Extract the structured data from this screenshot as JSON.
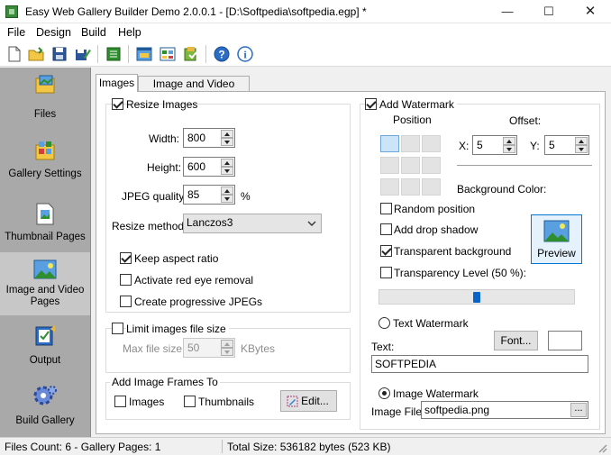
{
  "window": {
    "title": "Easy Web Gallery Builder Demo 2.0.0.1 - [D:\\Softpedia\\softpedia.egp] *"
  },
  "menu": [
    "File",
    "Design",
    "Build",
    "Help"
  ],
  "toolbar_icons": [
    "new-file-icon",
    "open-folder-icon",
    "save-icon",
    "save-as-icon",
    "generate-icon",
    "preview-icon",
    "gallery-layout-icon",
    "export-icon",
    "help-icon",
    "about-icon"
  ],
  "nav": [
    {
      "label": "Files",
      "icon": "files-icon"
    },
    {
      "label": "Gallery Settings",
      "icon": "gallery-settings-icon"
    },
    {
      "label": "Thumbnail Pages",
      "icon": "thumbnail-pages-icon"
    },
    {
      "label": "Image and Video Pages",
      "icon": "image-video-pages-icon",
      "selected": true
    },
    {
      "label": "Output",
      "icon": "output-icon"
    },
    {
      "label": "Build Gallery",
      "icon": "build-gallery-icon"
    }
  ],
  "tabs": {
    "images": "Images",
    "video": "Image and Video Pages"
  },
  "resize": {
    "title": "Resize Images",
    "width_label": "Width:",
    "width": "800",
    "height_label": "Height:",
    "height": "600",
    "jpeg_label": "JPEG quality:",
    "jpeg": "85",
    "jpeg_unit": "%",
    "method_label": "Resize method:",
    "method": "Lanczos3",
    "keep_aspect": "Keep aspect ratio",
    "red_eye": "Activate red eye removal",
    "progressive": "Create progressive JPEGs"
  },
  "limit": {
    "title": "Limit images file size",
    "max_label": "Max file size:",
    "max": "50",
    "unit": "KBytes"
  },
  "frames": {
    "title": "Add Image Frames To",
    "images": "Images",
    "thumbnails": "Thumbnails",
    "edit": "Edit..."
  },
  "watermark": {
    "title": "Add Watermark",
    "position_label": "Position",
    "offset_label": "Offset:",
    "x_label": "X:",
    "x": "5",
    "y_label": "Y:",
    "y": "5",
    "bg_label": "Background Color:",
    "random": "Random position",
    "shadow": "Add drop shadow",
    "transparent_bg": "Transparent background",
    "transparency": "Transparency Level (50 %):",
    "transparency_value": 0.5,
    "preview": "Preview",
    "text_wm": "Text Watermark",
    "font": "Font...",
    "text_label": "Text:",
    "text": "SOFTPEDIA",
    "image_wm": "Image Watermark",
    "file_label": "Image File:",
    "file": "softpedia.png",
    "browse": "..."
  },
  "status": {
    "left": "Files Count: 6 - Gallery Pages: 1",
    "right": "Total Size: 536182 bytes (523 KB)"
  },
  "colors": {
    "nav_bg": "#a9a9a9",
    "nav_selected": "#c7c7c7",
    "slider_thumb": "#0a64c8"
  }
}
